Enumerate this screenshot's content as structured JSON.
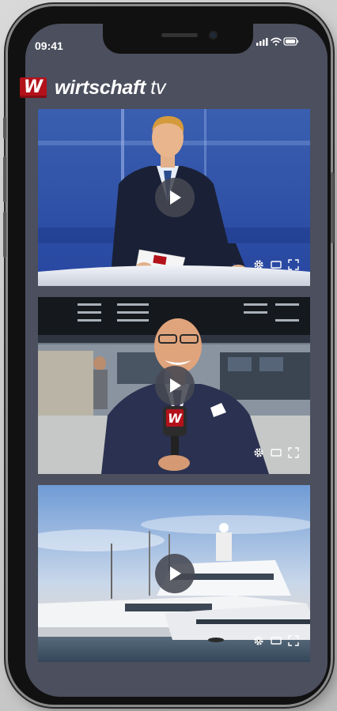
{
  "status": {
    "time": "09:41"
  },
  "header": {
    "logo_badge": "W",
    "logo_word": "wirtschaft",
    "logo_tv": "tv"
  },
  "videos": [
    {
      "scene": "news-studio-anchor"
    },
    {
      "scene": "stock-exchange-reporter"
    },
    {
      "scene": "yacht-harbor"
    }
  ],
  "colors": {
    "background": "#4b4f5e",
    "brand_red": "#b3121b"
  }
}
